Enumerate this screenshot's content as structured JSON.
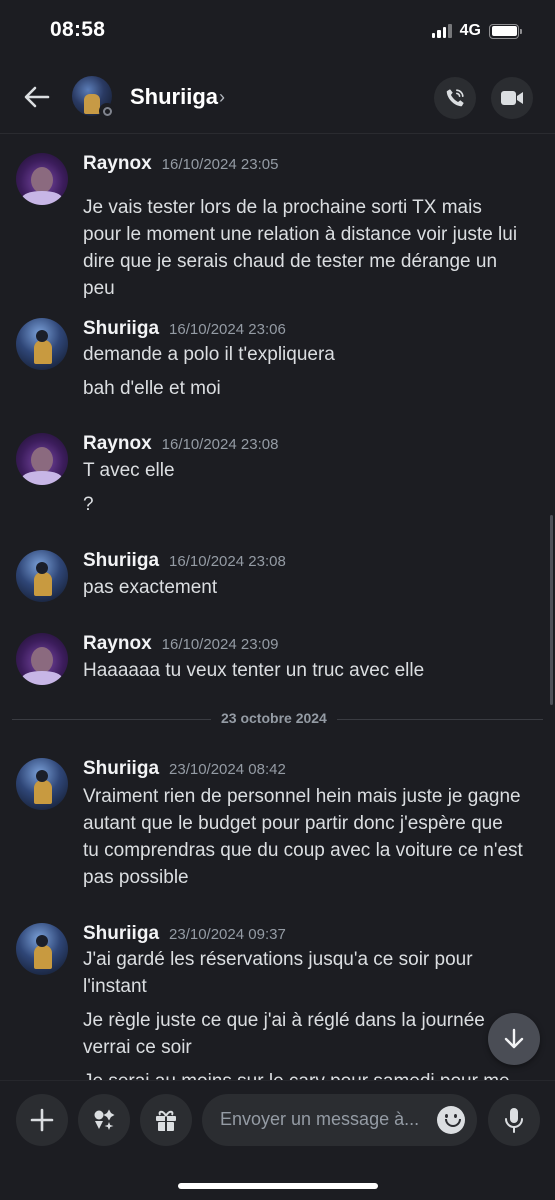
{
  "status_bar": {
    "time": "08:58",
    "network": "4G"
  },
  "header": {
    "name": "Shuriiga",
    "chevron": "›"
  },
  "messages": [
    {
      "author": "Raynox",
      "timestamp": "16/10/2024 23:05",
      "lines": [
        "Je vais tester lors de la prochaine sorti TX mais",
        "pour le moment une relation à distance voir juste lui",
        "dire que je serais chaud de tester me dérange un",
        "peu"
      ]
    },
    {
      "author": "Shuriiga",
      "timestamp": "16/10/2024 23:06",
      "lines": [
        "demande a polo il t'expliquera",
        "bah d'elle et moi"
      ]
    },
    {
      "author": "Raynox",
      "timestamp": "16/10/2024 23:08",
      "lines": [
        "T avec elle",
        "?"
      ]
    },
    {
      "author": "Shuriiga",
      "timestamp": "16/10/2024 23:08",
      "lines": [
        "pas exactement"
      ]
    },
    {
      "author": "Raynox",
      "timestamp": "16/10/2024 23:09",
      "lines": [
        "Haaaaaa tu veux tenter un truc avec elle"
      ]
    },
    {
      "author": "Shuriiga",
      "timestamp": "23/10/2024 08:42",
      "lines": [
        "Vraiment rien de personnel hein mais juste je gagne",
        "autant que le budget pour partir donc j'espère que",
        "tu comprendras que du coup avec la voiture ce n'est",
        "pas possible"
      ]
    },
    {
      "author": "Shuriiga",
      "timestamp": "23/10/2024 09:37",
      "lines": [
        "J'ai gardé les réservations jusqu'a ce soir pour",
        "l'instant",
        "Je règle juste ce que j'ai à réglé dans la journée",
        "verrai ce soir",
        "Je serai au moins sur le carv pour samedi pour me"
      ]
    }
  ],
  "date_divider": "23 octobre 2024",
  "composer": {
    "placeholder": "Envoyer un message à..."
  },
  "icons": [
    "back-arrow-icon",
    "phone-icon",
    "video-camera-icon",
    "plus-icon",
    "apps-icon",
    "gift-icon",
    "emoji-icon",
    "microphone-icon",
    "arrow-down-icon"
  ]
}
